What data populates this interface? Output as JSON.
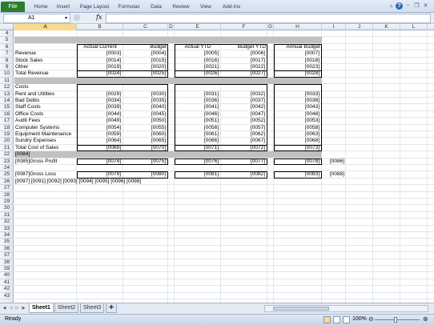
{
  "ribbon": {
    "file_label": "File",
    "tabs": [
      "Home",
      "Insert",
      "Page Layout",
      "Formulas",
      "Data",
      "Review",
      "View",
      "Add-Ins"
    ],
    "window_icons": [
      "minimize-icon",
      "help-icon",
      "restore-icon",
      "close-icon"
    ]
  },
  "formula_bar": {
    "name_box": "A1",
    "fx_label": "fx",
    "formula": ""
  },
  "columns": [
    "A",
    "B",
    "C",
    "D",
    "E",
    "F",
    "G",
    "H",
    "I",
    "J",
    "K",
    "L"
  ],
  "selected_column": "A",
  "rows": [
    "4",
    "5",
    "6",
    "7",
    "8",
    "9",
    "10",
    "11",
    "12",
    "13",
    "14",
    "15",
    "16",
    "17",
    "18",
    "19",
    "20",
    "21",
    "22",
    "23",
    "24",
    "25",
    "26",
    "27",
    "28",
    "29",
    "30",
    "31",
    "32",
    "33",
    "34",
    "35",
    "36",
    "37",
    "38",
    "39",
    "40",
    "41",
    "42",
    "43"
  ],
  "headers": {
    "actual_current": "Actual Current",
    "budget": "Budget",
    "actual_ytd": "Actual YTD",
    "budget_ytd": "Budget YTD",
    "annual_budget": "Annual Budget"
  },
  "revenue": [
    {
      "label": "Revenue",
      "vals": [
        "[0003]",
        "[0004]",
        "[0005]",
        "[0006]",
        "[0007]"
      ]
    },
    {
      "label": "Stock Sales",
      "vals": [
        "[0014]",
        "[0015]",
        "[0016]",
        "[0017]",
        "[0018]"
      ]
    },
    {
      "label": "Other",
      "vals": [
        "[0019]",
        "[0020]",
        "[0021]",
        "[0022]",
        "[0023]"
      ]
    },
    {
      "label": "Total Revenue",
      "vals": [
        "[0024]",
        "[0025]",
        "[0026]",
        "[0027]",
        "[0028]"
      ]
    }
  ],
  "costs_label": "Costs",
  "costs": [
    {
      "label": "Rent and Utilities",
      "vals": [
        "[0029]",
        "[0030]",
        "[0031]",
        "[0032]",
        "[0033]"
      ]
    },
    {
      "label": "Bad Debts",
      "vals": [
        "[0034]",
        "[0035]",
        "[0036]",
        "[0037]",
        "[0038]"
      ]
    },
    {
      "label": "Staff Costs",
      "vals": [
        "[0039]",
        "[0040]",
        "[0041]",
        "[0042]",
        "[0043]"
      ]
    },
    {
      "label": "Office Costs",
      "vals": [
        "[0044]",
        "[0045]",
        "[0046]",
        "[0047]",
        "[0048]"
      ]
    },
    {
      "label": "Audit Fees",
      "vals": [
        "[0049]",
        "[0050]",
        "[0051]",
        "[0052]",
        "[0053]"
      ]
    },
    {
      "label": "Computer Systems",
      "vals": [
        "[0054]",
        "[0055]",
        "[0056]",
        "[0057]",
        "[0058]"
      ]
    },
    {
      "label": "Equipment Maintenance",
      "vals": [
        "[0059]",
        "[0060]",
        "[0061]",
        "[0062]",
        "[0063]"
      ]
    },
    {
      "label": "Sundry Expenses",
      "vals": [
        "[0064]",
        "[0065]",
        "[0066]",
        "[0067]",
        "[0068]"
      ]
    },
    {
      "label": "Total Cost of Sales",
      "vals": [
        "[0069]",
        "[0070]",
        "[0071]",
        "[0072]",
        "[0073]"
      ]
    }
  ],
  "row22_text": "[0084]",
  "gross_profit": {
    "label": "[0085]Gross Profit",
    "vals": [
      "[0074]",
      "[0075]",
      "[0076]",
      "[0077]",
      "[0078]"
    ],
    "extra": "[0086]"
  },
  "gross_loss": {
    "label": "[0087]Gross Loss",
    "vals": [
      "[0079]",
      "[0080]",
      "[0081]",
      "[0082]",
      "[0083]"
    ],
    "extra": "[0088]"
  },
  "row26_text": "[0097] [0091] [0092] [0093] [0094] [0095] [0096] [0098]",
  "sheets": [
    "Sheet1",
    "Sheet2",
    "Sheet3"
  ],
  "active_sheet": "Sheet1",
  "status": {
    "ready": "Ready",
    "zoom": "100%"
  }
}
